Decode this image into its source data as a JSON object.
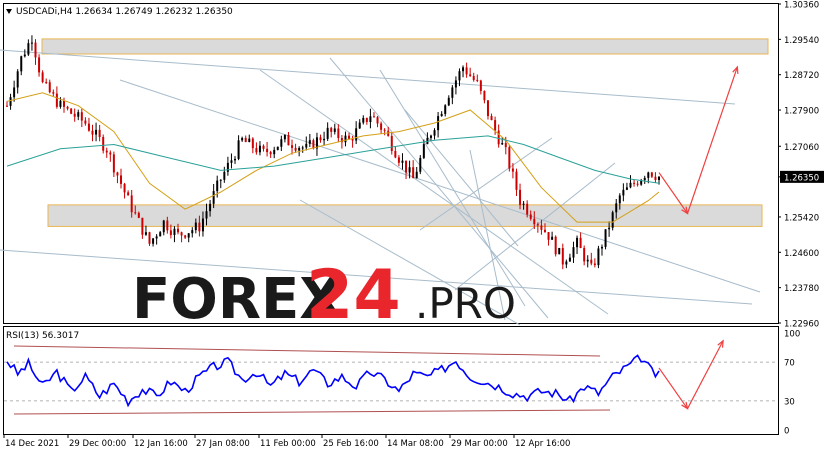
{
  "header": {
    "symbol_line": "USDCADi,H4  1.26634 1.26749 1.26232 1.26350"
  },
  "watermark": {
    "brand_left": "FOREX",
    "brand_num": "24",
    "brand_right": ".PRO"
  },
  "colors": {
    "bull_candle": "#000000",
    "bear_candle": "#cc0000",
    "ma_fast": "#d4a017",
    "ma_slow": "#2aa198",
    "rsi_line": "#0000ff",
    "arrow": "#f04040",
    "zone_fill": "#d9d9d9",
    "zone_border": "#e8b24a",
    "channel_line": "#a8bccb",
    "brand_dark": "#1a1a1a",
    "brand_red": "#e8262b"
  },
  "chart_data": [
    {
      "type": "candlestick",
      "instrument": "USDCADi",
      "timeframe": "H4",
      "ohlc_header": {
        "open": 1.26634,
        "high": 1.26749,
        "low": 1.26232,
        "close": 1.2635
      },
      "current_price_label": "1.26350",
      "ylim": [
        1.2296,
        1.3036
      ],
      "y_ticks": [
        "1.30360",
        "1.29540",
        "1.28720",
        "1.27900",
        "1.27060",
        "1.26350",
        "1.25420",
        "1.24600",
        "1.23780",
        "1.22960"
      ],
      "x_ticks": [
        "14 Dec 2021",
        "29 Dec 00:00",
        "12 Jan 16:00",
        "27 Jan 08:00",
        "11 Feb 00:00",
        "25 Feb 16:00",
        "14 Mar 08:00",
        "29 Mar 00:00",
        "12 Apr 16:00"
      ],
      "close_path": [
        [
          0,
          1.28
        ],
        [
          4,
          1.291
        ],
        [
          7,
          1.296
        ],
        [
          10,
          1.285
        ],
        [
          15,
          1.28
        ],
        [
          22,
          1.276
        ],
        [
          28,
          1.27
        ],
        [
          34,
          1.258
        ],
        [
          40,
          1.248
        ],
        [
          44,
          1.253
        ],
        [
          48,
          1.25
        ],
        [
          54,
          1.252
        ],
        [
          60,
          1.263
        ],
        [
          66,
          1.272
        ],
        [
          72,
          1.269
        ],
        [
          78,
          1.272
        ],
        [
          84,
          1.27
        ],
        [
          90,
          1.274
        ],
        [
          96,
          1.272
        ],
        [
          102,
          1.278
        ],
        [
          106,
          1.274
        ],
        [
          110,
          1.268
        ],
        [
          114,
          1.263
        ],
        [
          118,
          1.272
        ],
        [
          124,
          1.283
        ],
        [
          128,
          1.289
        ],
        [
          132,
          1.285
        ],
        [
          136,
          1.276
        ],
        [
          140,
          1.269
        ],
        [
          144,
          1.258
        ],
        [
          148,
          1.254
        ],
        [
          152,
          1.25
        ],
        [
          156,
          1.244
        ],
        [
          160,
          1.248
        ],
        [
          164,
          1.242
        ],
        [
          168,
          1.25
        ],
        [
          172,
          1.259
        ],
        [
          176,
          1.262
        ],
        [
          180,
          1.265
        ],
        [
          183,
          1.2635
        ]
      ],
      "ma_fast_path": [
        [
          0,
          1.281
        ],
        [
          10,
          1.283
        ],
        [
          20,
          1.28
        ],
        [
          30,
          1.274
        ],
        [
          40,
          1.262
        ],
        [
          50,
          1.256
        ],
        [
          60,
          1.26
        ],
        [
          70,
          1.265
        ],
        [
          80,
          1.269
        ],
        [
          90,
          1.271
        ],
        [
          100,
          1.273
        ],
        [
          110,
          1.274
        ],
        [
          120,
          1.276
        ],
        [
          130,
          1.279
        ],
        [
          140,
          1.272
        ],
        [
          150,
          1.261
        ],
        [
          160,
          1.253
        ],
        [
          170,
          1.253
        ],
        [
          180,
          1.258
        ],
        [
          183,
          1.26
        ]
      ],
      "ma_slow_path": [
        [
          0,
          1.266
        ],
        [
          15,
          1.27
        ],
        [
          30,
          1.271
        ],
        [
          45,
          1.268
        ],
        [
          60,
          1.265
        ],
        [
          75,
          1.266
        ],
        [
          90,
          1.268
        ],
        [
          105,
          1.27
        ],
        [
          120,
          1.272
        ],
        [
          135,
          1.273
        ],
        [
          145,
          1.271
        ],
        [
          155,
          1.268
        ],
        [
          165,
          1.265
        ],
        [
          175,
          1.263
        ],
        [
          183,
          1.262
        ]
      ],
      "zones": [
        {
          "from": 1.292,
          "to": 1.2955
        },
        {
          "from": 1.252,
          "to": 1.257
        }
      ],
      "forecast_arrows": [
        {
          "from": [
            183,
            1.2645
          ],
          "to": [
            191,
            1.255
          ]
        },
        {
          "from": [
            191,
            1.255
          ],
          "to": [
            205,
            1.289
          ]
        }
      ]
    },
    {
      "type": "line",
      "name": "RSI(13) 56.3017",
      "ylim": [
        0,
        100
      ],
      "y_ticks": [
        "100",
        "70",
        "30",
        "0"
      ],
      "levels": [
        70,
        30
      ],
      "values_path": [
        [
          0,
          72
        ],
        [
          3,
          58
        ],
        [
          6,
          68
        ],
        [
          10,
          45
        ],
        [
          14,
          60
        ],
        [
          18,
          40
        ],
        [
          22,
          55
        ],
        [
          26,
          35
        ],
        [
          30,
          48
        ],
        [
          34,
          30
        ],
        [
          38,
          42
        ],
        [
          42,
          35
        ],
        [
          46,
          50
        ],
        [
          50,
          40
        ],
        [
          54,
          55
        ],
        [
          58,
          65
        ],
        [
          62,
          70
        ],
        [
          66,
          52
        ],
        [
          70,
          60
        ],
        [
          74,
          45
        ],
        [
          78,
          58
        ],
        [
          82,
          50
        ],
        [
          86,
          62
        ],
        [
          90,
          48
        ],
        [
          94,
          55
        ],
        [
          98,
          45
        ],
        [
          102,
          60
        ],
        [
          106,
          52
        ],
        [
          110,
          40
        ],
        [
          114,
          58
        ],
        [
          118,
          55
        ],
        [
          122,
          62
        ],
        [
          126,
          72
        ],
        [
          130,
          55
        ],
        [
          134,
          50
        ],
        [
          138,
          45
        ],
        [
          142,
          38
        ],
        [
          146,
          35
        ],
        [
          150,
          40
        ],
        [
          154,
          38
        ],
        [
          158,
          30
        ],
        [
          162,
          45
        ],
        [
          166,
          38
        ],
        [
          170,
          55
        ],
        [
          174,
          65
        ],
        [
          178,
          75
        ],
        [
          181,
          60
        ],
        [
          183,
          56
        ]
      ],
      "forecast_arrows": [
        {
          "from": [
            183,
            64
          ],
          "to": [
            191,
            22
          ]
        },
        {
          "from": [
            191,
            22
          ],
          "to": [
            201,
            92
          ]
        }
      ]
    }
  ]
}
